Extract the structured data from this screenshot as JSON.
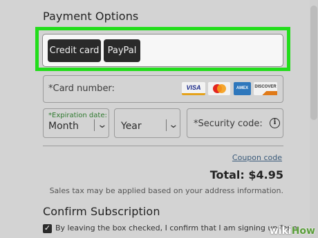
{
  "payment": {
    "title": "Payment Options",
    "methods": [
      "Credit card",
      "PayPal"
    ]
  },
  "card_form": {
    "card_number_label": "*Card number:",
    "card_logos": [
      "VISA",
      "MasterCard",
      "AMEX",
      "DISCOVER"
    ],
    "expiration_label": "*Expiration date:",
    "month_value": "Month",
    "year_value": "Year",
    "security_label": "*Security code:",
    "info_icon": "i"
  },
  "summary": {
    "coupon_link": "Coupon code",
    "total": "Total: $4.95",
    "tax_note": "Sales tax may be applied based on your address information."
  },
  "confirm": {
    "title": "Confirm Subscription",
    "consent_text": "By leaving the box checked, I confirm that I am signing up for a",
    "checked": true
  },
  "watermark": {
    "part1": "wiki",
    "part2": "How"
  },
  "colors": {
    "highlight": "#22dd1b",
    "button": "#2a2a2a",
    "background": "#d3d3d3"
  }
}
